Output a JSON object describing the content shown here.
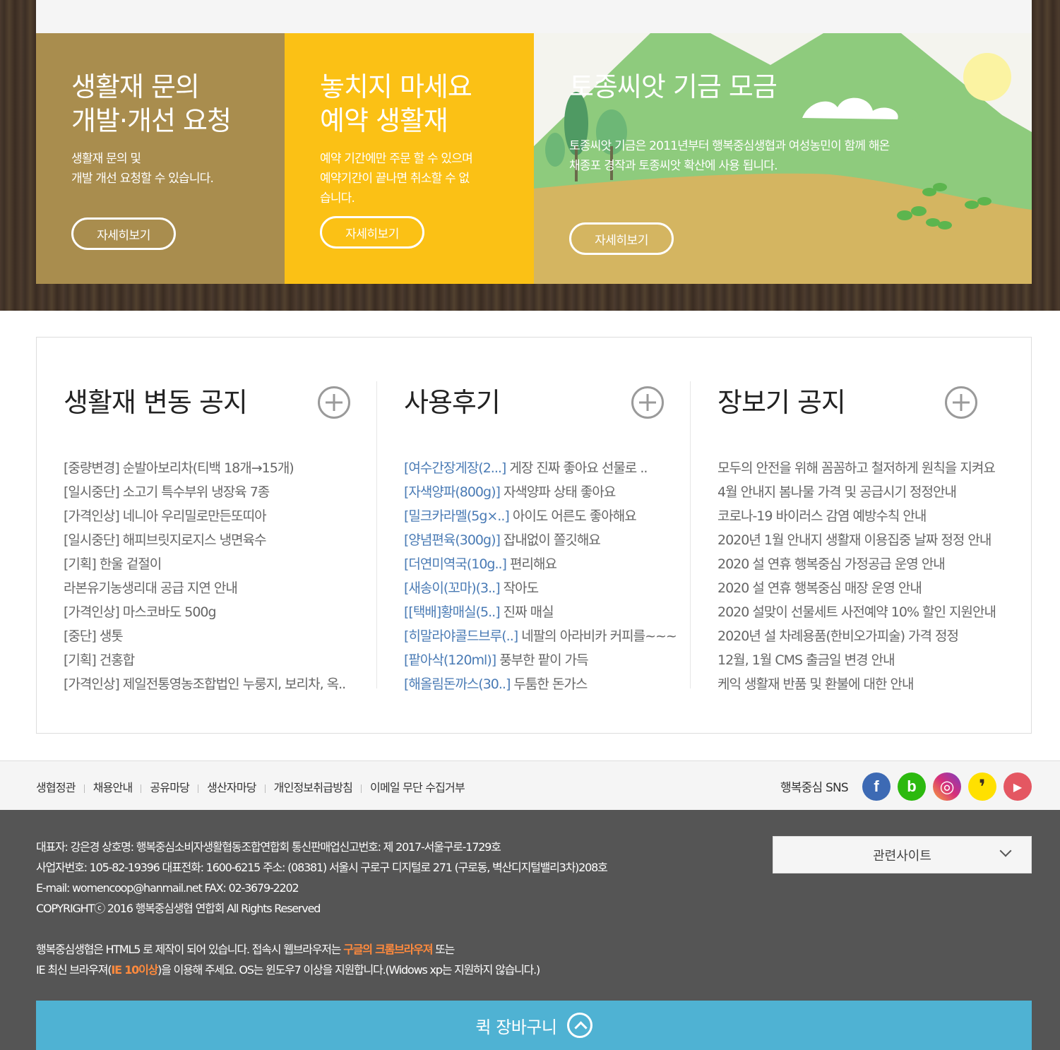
{
  "promos": [
    {
      "title_line1": "생활재 문의",
      "title_line2": "개발·개선 요청",
      "desc_line1": "생활재 문의 및",
      "desc_line2": "개발 개선 요청할 수 있습니다.",
      "desc_line3": "",
      "button": "자세히보기",
      "color": "#a98d4e"
    },
    {
      "title_line1": "놓치지 마세요",
      "title_line2": "예약 생활재",
      "desc_line1": "예약 기간에만 주문 할 수 있으며",
      "desc_line2": "예약기간이 끝나면 취소할 수 없",
      "desc_line3": "습니다.",
      "button": "자세히보기",
      "color": "#fbc115"
    },
    {
      "title_line1": "토종씨앗 기금 모금",
      "desc_line1": "토종씨앗 기금은 2011년부터 행복중심생협과 여성농민이 함께 해온",
      "desc_line2": "채종포 경작과 토종씨앗 확산에 사용 됩니다.",
      "button": "자세히보기"
    }
  ],
  "boards": [
    {
      "title": "생활재 변동 공지",
      "items": [
        "[중량변경] 순발아보리차(티백 18개→15개)",
        "[일시중단] 소고기 특수부위 냉장육 7종",
        "[가격인상] 네니아 우리밀로만든또띠아",
        "[일시중단] 해피브릿지로지스 냉면육수",
        "[기획] 한울 겉절이",
        "라본유기농생리대 공급 지연 안내",
        "[가격인상] 마스코바도 500g",
        "[중단] 생톳",
        "[기획] 건홍합",
        "[가격인상] 제일전통영농조합법인 누룽지, 보리차, 옥.."
      ]
    },
    {
      "title": "사용후기",
      "items": [
        {
          "tag": "[여수간장게장(2...]",
          "text": " 게장 진짜 좋아요 선물로 .."
        },
        {
          "tag": "[자색양파(800g)]",
          "text": " 자색양파 상태 좋아요"
        },
        {
          "tag": "[밀크카라멜(5g×..]",
          "text": " 아이도 어른도 좋아해요"
        },
        {
          "tag": "[양념편육(300g)]",
          "text": " 잡내없이 쫄깃해요"
        },
        {
          "tag": "[더연미역국(10g..]",
          "text": " 편리해요"
        },
        {
          "tag": "[새송이(꼬마)(3..]",
          "text": " 작아도"
        },
        {
          "tag": "[[택배]황매실(5..]",
          "text": " 진짜 매실"
        },
        {
          "tag": "[히말라야콜드브루(..]",
          "text": " 네팔의 아라비카 커피를~~~"
        },
        {
          "tag": "[팥아삭(120ml)]",
          "text": " 풍부한 팥이 가득"
        },
        {
          "tag": "[해올림돈까스(30..]",
          "text": " 두툼한 돈가스"
        }
      ]
    },
    {
      "title": "장보기 공지",
      "items": [
        "모두의 안전을 위해 꼼꼼하고 철저하게 원칙을 지켜요",
        "4월 안내지 봄나물 가격 및 공급시기 정정안내",
        "코로나-19 바이러스 감염 예방수칙 안내",
        "2020년 1월 안내지 생활재 이용집중 날짜 정정 안내",
        "2020 설 연휴 행복중심 가정공급 운영 안내",
        "2020 설 연휴 행복중심 매장 운영 안내",
        "2020 설맞이 선물세트 사전예약 10% 할인 지원안내",
        "2020년 설 차례용품(한비오가피술) 가격 정정",
        "12월, 1월 CMS 출금일 변경 안내",
        "케익 생활재 반품 및 환불에 대한 안내"
      ]
    }
  ],
  "footer_links": [
    "생협정관",
    "채용안내",
    "공유마당",
    "생산자마당",
    "개인정보취급방침",
    "이메일 무단 수집거부"
  ],
  "sns": {
    "label": "행복중심 SNS",
    "icons": [
      {
        "name": "facebook-icon",
        "glyph": "f",
        "color": "#3d6ab4"
      },
      {
        "name": "band-icon",
        "glyph": "b",
        "color": "#2cb90f"
      },
      {
        "name": "instagram-icon",
        "glyph": "◎",
        "color": "#c6337f"
      },
      {
        "name": "kakaostory-icon",
        "glyph": "❜",
        "color": "#ffe000"
      },
      {
        "name": "youtube-icon",
        "glyph": "▶",
        "color": "#e45762"
      }
    ]
  },
  "company_info": {
    "line1": "대표자: 강은경 상호명: 행복중심소비자생활협동조합연합회 통신판매업신고번호: 제 2017-서울구로-1729호",
    "line2": "사업자번호: 105-82-19396 대표전화: 1600-6215 주소: (08381) 서울시 구로구 디지털로 271 (구로동, 벽산디지털밸리3차)208호",
    "line3": "E-mail: womencoop@hanmail.net FAX: 02-3679-2202",
    "line4": "COPYRIGHTⓒ 2016 행복중심생협 연합회 All Rights Reserved",
    "notice1_a": "행복중심생협은 HTML5 로 제작이 되어 있습니다. 접속시 웹브라우저는 ",
    "notice1_hl": "구글의 크롬브라우져",
    "notice1_b": " 또는",
    "notice2_a": "IE 최신 브라우져(",
    "notice2_hl": "IE 10이상",
    "notice2_b": ")을 이용해 주세요. OS는 윈도우7 이상을 지원합니다.(Widows xp는 지원하지 않습니다.)"
  },
  "related_sites": {
    "selected": "관련사이트"
  },
  "quick_cart": {
    "label": "퀵 장바구니"
  }
}
